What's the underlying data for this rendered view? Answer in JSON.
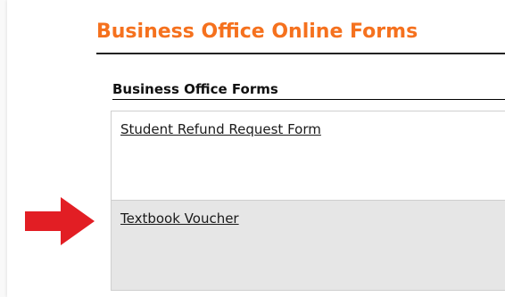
{
  "page": {
    "title": "Business Office Online Forms",
    "title_color": "#f5711e"
  },
  "section": {
    "heading": "Business Office Forms"
  },
  "forms": [
    {
      "label": "Student Refund Request Form"
    },
    {
      "label": "Textbook Voucher"
    }
  ],
  "annotation": {
    "icon": "arrow-right-icon",
    "color": "#e21e24"
  }
}
